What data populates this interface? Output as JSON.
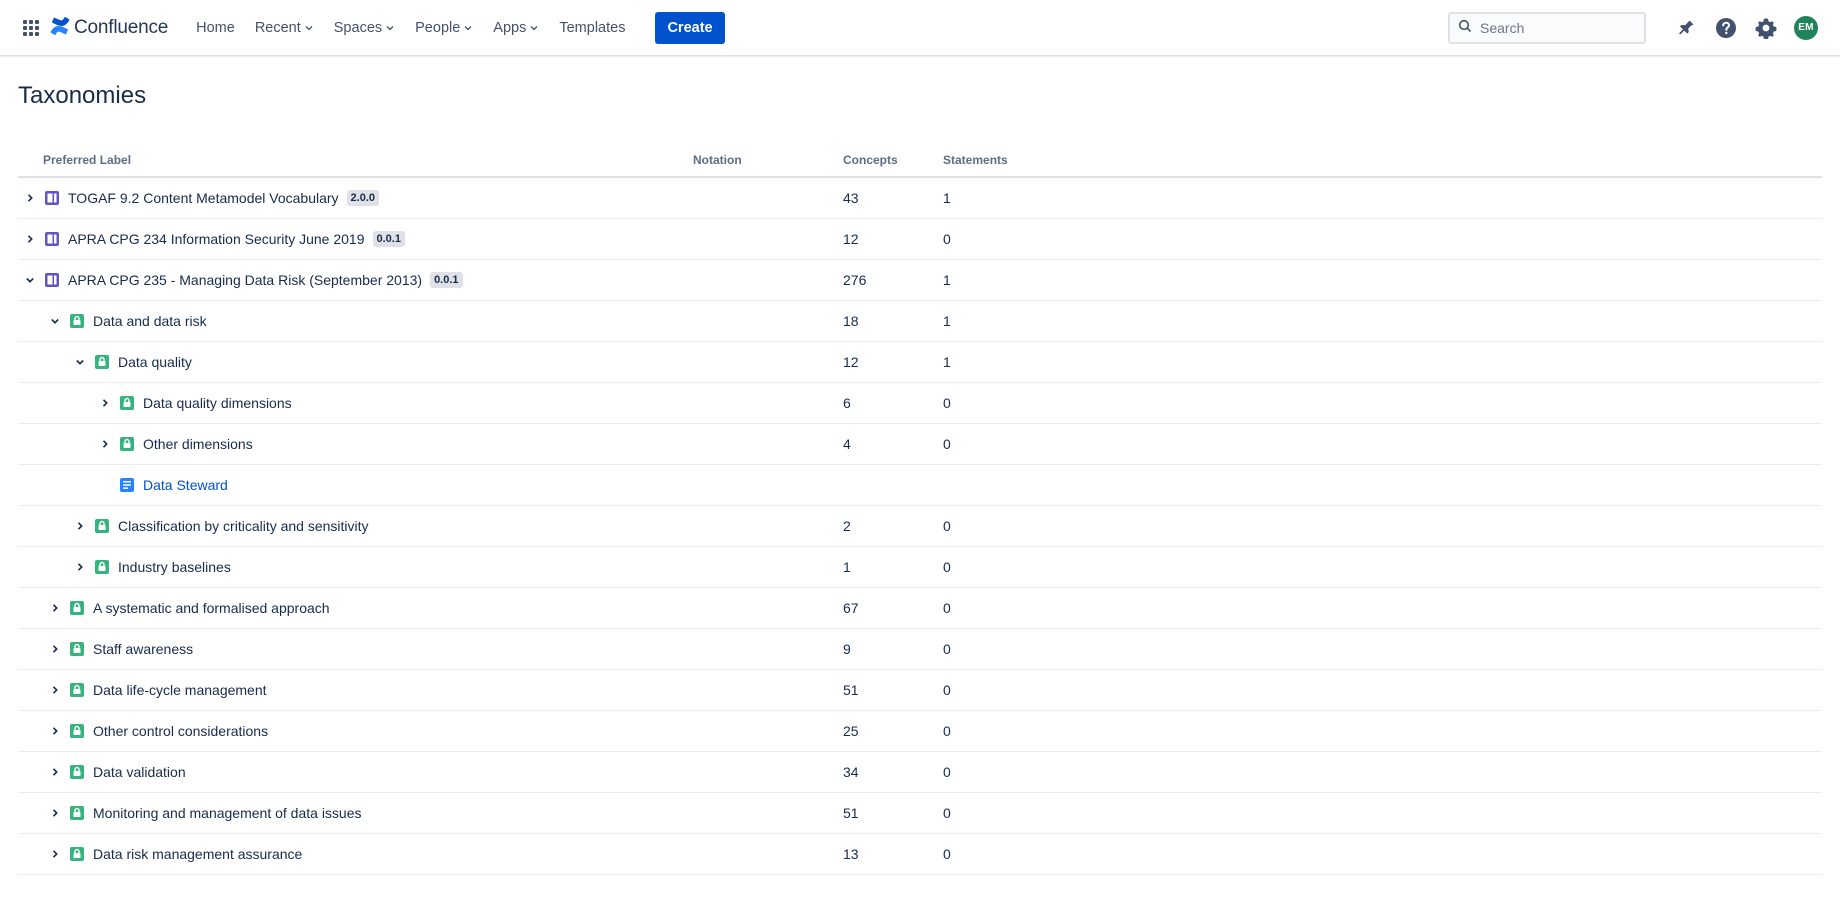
{
  "nav": {
    "app_name": "Confluence",
    "items": [
      {
        "label": "Home",
        "dropdown": false
      },
      {
        "label": "Recent",
        "dropdown": true
      },
      {
        "label": "Spaces",
        "dropdown": true
      },
      {
        "label": "People",
        "dropdown": true
      },
      {
        "label": "Apps",
        "dropdown": true
      },
      {
        "label": "Templates",
        "dropdown": false
      }
    ],
    "create_label": "Create",
    "search_placeholder": "Search",
    "avatar_initials": "EM",
    "icons": [
      "app-switcher-icon",
      "confluence-logo-icon",
      "notifications-icon",
      "help-icon",
      "settings-icon"
    ]
  },
  "page": {
    "title": "Taxonomies"
  },
  "table": {
    "headers": {
      "label": "Preferred Label",
      "notation": "Notation",
      "concepts": "Concepts",
      "statements": "Statements"
    },
    "rows": [
      {
        "level": 0,
        "toggle": "collapsed",
        "icon": "taxonomy",
        "label": "TOGAF 9.2 Content Metamodel Vocabulary",
        "version": "2.0.0",
        "notation": "",
        "concepts": "43",
        "statements": "1"
      },
      {
        "level": 0,
        "toggle": "collapsed",
        "icon": "taxonomy",
        "label": "APRA CPG 234 Information Security June 2019",
        "version": "0.0.1",
        "notation": "",
        "concepts": "12",
        "statements": "0"
      },
      {
        "level": 0,
        "toggle": "expanded",
        "icon": "taxonomy",
        "label": "APRA CPG 235 - Managing Data Risk (September 2013)",
        "version": "0.0.1",
        "notation": "",
        "concepts": "276",
        "statements": "1"
      },
      {
        "level": 1,
        "toggle": "expanded",
        "icon": "concept",
        "label": "Data and data risk",
        "version": "",
        "notation": "",
        "concepts": "18",
        "statements": "1"
      },
      {
        "level": 2,
        "toggle": "expanded",
        "icon": "concept",
        "label": "Data quality",
        "version": "",
        "notation": "",
        "concepts": "12",
        "statements": "1"
      },
      {
        "level": 3,
        "toggle": "collapsed",
        "icon": "concept",
        "label": "Data quality dimensions",
        "version": "",
        "notation": "",
        "concepts": "6",
        "statements": "0"
      },
      {
        "level": 3,
        "toggle": "collapsed",
        "icon": "concept",
        "label": "Other dimensions",
        "version": "",
        "notation": "",
        "concepts": "4",
        "statements": "0"
      },
      {
        "level": 3,
        "toggle": "none",
        "icon": "page",
        "label": "Data Steward",
        "version": "",
        "notation": "",
        "concepts": "",
        "statements": "",
        "link": true
      },
      {
        "level": 2,
        "toggle": "collapsed",
        "icon": "concept",
        "label": "Classification by criticality and sensitivity",
        "version": "",
        "notation": "",
        "concepts": "2",
        "statements": "0"
      },
      {
        "level": 2,
        "toggle": "collapsed",
        "icon": "concept",
        "label": "Industry baselines",
        "version": "",
        "notation": "",
        "concepts": "1",
        "statements": "0"
      },
      {
        "level": 1,
        "toggle": "collapsed",
        "icon": "concept",
        "label": "A systematic and formalised approach",
        "version": "",
        "notation": "",
        "concepts": "67",
        "statements": "0"
      },
      {
        "level": 1,
        "toggle": "collapsed",
        "icon": "concept",
        "label": "Staff awareness",
        "version": "",
        "notation": "",
        "concepts": "9",
        "statements": "0"
      },
      {
        "level": 1,
        "toggle": "collapsed",
        "icon": "concept",
        "label": "Data life-cycle management",
        "version": "",
        "notation": "",
        "concepts": "51",
        "statements": "0"
      },
      {
        "level": 1,
        "toggle": "collapsed",
        "icon": "concept",
        "label": "Other control considerations",
        "version": "",
        "notation": "",
        "concepts": "25",
        "statements": "0"
      },
      {
        "level": 1,
        "toggle": "collapsed",
        "icon": "concept",
        "label": "Data validation",
        "version": "",
        "notation": "",
        "concepts": "34",
        "statements": "0"
      },
      {
        "level": 1,
        "toggle": "collapsed",
        "icon": "concept",
        "label": "Monitoring and management of data issues",
        "version": "",
        "notation": "",
        "concepts": "51",
        "statements": "0"
      },
      {
        "level": 1,
        "toggle": "collapsed",
        "icon": "concept",
        "label": "Data risk management assurance",
        "version": "",
        "notation": "",
        "concepts": "13",
        "statements": "0"
      }
    ]
  },
  "colors": {
    "brand_blue": "#0052cc",
    "taxonomy_icon": "#6554c0",
    "concept_icon": "#36b37e",
    "page_icon": "#2684ff",
    "avatar": "#1f845a"
  }
}
